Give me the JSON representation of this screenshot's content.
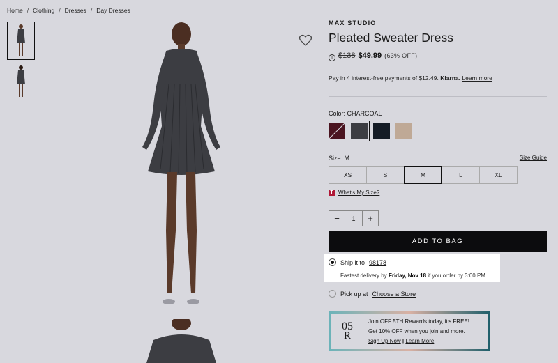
{
  "breadcrumb": [
    "Home",
    "Clothing",
    "Dresses",
    "Day Dresses"
  ],
  "product": {
    "brand": "MAX STUDIO",
    "title": "Pleated Sweater Dress",
    "old_price": "$138",
    "new_price": "$49.99",
    "discount": "(63% OFF)"
  },
  "klarna": {
    "text": "Pay in 4 interest-free payments of $12.49.",
    "brand": "Klarna.",
    "link": "Learn more"
  },
  "color": {
    "label": "Color:",
    "value": "CHARCOAL",
    "swatches": [
      {
        "name": "burgundy",
        "color": "#4a1420"
      },
      {
        "name": "charcoal",
        "color": "#3c3d42"
      },
      {
        "name": "navy",
        "color": "#151c26"
      },
      {
        "name": "taupe",
        "color": "#bfa996"
      }
    ],
    "selected_index": 1
  },
  "size": {
    "label": "Size:",
    "value": "M",
    "guide": "Size Guide",
    "options": [
      "XS",
      "S",
      "M",
      "L",
      "XL"
    ],
    "whats_my_size": "What's My Size?"
  },
  "quantity": {
    "minus": "−",
    "value": "1",
    "plus": "+"
  },
  "add_to_bag": "ADD TO BAG",
  "shipping": {
    "ship_label": "Ship it to",
    "zip": "98178",
    "delivery_prefix": "Fastest delivery by",
    "delivery_date": "Friday, Nov 18",
    "delivery_suffix": "if you order by 3:00 PM.",
    "pickup_label": "Pick up at",
    "pickup_link": "Choose a Store"
  },
  "rewards": {
    "logo_top": "05",
    "logo_bottom": "R",
    "headline": "Join OFF 5TH Rewards today, it's FREE!",
    "subtext": "Get 10% OFF when you join and more.",
    "signup": "Sign Up Now",
    "sep": "|",
    "learn": "Learn More"
  }
}
